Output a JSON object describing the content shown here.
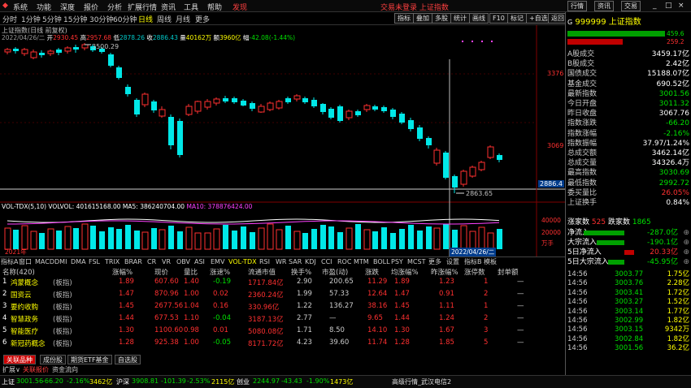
{
  "menu": {
    "items": [
      "系统",
      "功能",
      "深度",
      "报价",
      "分析",
      "扩展行情",
      "资讯",
      "工具",
      "帮助",
      "发现"
    ],
    "center_text": "交易未登录 上证指数",
    "right_buttons": [
      "行情",
      "资讯",
      "交易"
    ],
    "window_controls": [
      "_",
      "□",
      "×"
    ]
  },
  "toolbar": {
    "periods": [
      "分时",
      "1分钟",
      "5分钟",
      "15分钟",
      "30分钟",
      "60分钟",
      "日线",
      "周线",
      "月线",
      "更多"
    ],
    "active_period": "日线",
    "right_buttons": [
      "指标",
      "叠加",
      "多股",
      "统计",
      "画线",
      "F10",
      "标记",
      "+自选",
      "返回"
    ]
  },
  "chart_header": {
    "title": "上证指数(日线 前复权)",
    "date": "2022/04/26/二",
    "open_label": "开",
    "open": "2930.45",
    "high_label": "高",
    "high": "2957.68",
    "low_label": "低",
    "low": "2878.26",
    "close_label": "收",
    "close": "2886.43",
    "vol_label": "量",
    "vol": "40162万",
    "amt_label": "额",
    "amt": "3960亿",
    "chg_label": "幅",
    "chg": "-42.08(-1.44%)"
  },
  "price_axis": [
    "3376",
    "3069",
    "2886.4"
  ],
  "annotations": {
    "high_mark": "3500.29",
    "low_mark": "2863.65"
  },
  "volume_header": {
    "name": "VOL-TDX(5,10)",
    "vol": "VOLVOL: 401615168.00",
    "ma5": "MA5: 386240704.00",
    "ma10": "MA10: 378876424.00"
  },
  "volume_axis": [
    "40000",
    "20000",
    "万手"
  ],
  "chart_date_labels": {
    "left": "2021年",
    "cursor": "2022/04/26/二"
  },
  "indicator_tabs": [
    "指标A",
    "窗口",
    "MACD",
    "DMI",
    "DMA",
    "FSL",
    "TRIX",
    "BRAR",
    "CR",
    "VR",
    "OBV",
    "ASI",
    "EMV",
    "VOL-TDX",
    "RSI",
    "WR",
    "SAR",
    "KDJ",
    "CCI",
    "ROC",
    "MTM",
    "BOLL",
    "PSY",
    "MCST",
    "更多",
    "设置",
    "指标B",
    "模板"
  ],
  "table": {
    "headers": [
      "名称(420)",
      "涨幅%",
      "现价",
      "量比",
      "涨速%",
      "流通市值",
      "换手%",
      "市盈(动)",
      "涨跌",
      "均涨幅%",
      "昨涨幅%",
      "涨停数",
      "封单额"
    ],
    "rows": [
      {
        "idx": "1",
        "name": "鸿蒙概念",
        "tag": "(板指)",
        "chg": "1.89",
        "price": "607.60",
        "vr": "1.40",
        "speed": "-0.19",
        "cap": "1717.84亿",
        "turn": "2.90",
        "pe": "200.65",
        "diff": "11.29",
        "avg": "1.89",
        "prev": "1.23",
        "lim": "1",
        "seal": "—"
      },
      {
        "idx": "2",
        "name": "国资云",
        "tag": "(板指)",
        "chg": "1.47",
        "price": "870.96",
        "vr": "1.00",
        "speed": "0.02",
        "cap": "2360.24亿",
        "turn": "1.99",
        "pe": "57.33",
        "diff": "12.64",
        "avg": "1.47",
        "prev": "0.91",
        "lim": "2",
        "seal": "—"
      },
      {
        "idx": "3",
        "name": "要约收购",
        "tag": "(板指)",
        "chg": "1.45",
        "price": "2677.56",
        "vr": "1.04",
        "speed": "0.16",
        "cap": "330.96亿",
        "turn": "1.22",
        "pe": "136.27",
        "diff": "38.16",
        "avg": "1.45",
        "prev": "1.11",
        "lim": "1",
        "seal": "—"
      },
      {
        "idx": "4",
        "name": "智慧政务",
        "tag": "(板指)",
        "chg": "1.44",
        "price": "677.53",
        "vr": "1.10",
        "speed": "-0.04",
        "cap": "3187.13亿",
        "turn": "2.77",
        "pe": "—",
        "diff": "9.65",
        "avg": "1.44",
        "prev": "1.24",
        "lim": "2",
        "seal": "—"
      },
      {
        "idx": "5",
        "name": "智能医疗",
        "tag": "(板指)",
        "chg": "1.30",
        "price": "1100.60",
        "vr": "0.98",
        "speed": "0.01",
        "cap": "5080.08亿",
        "turn": "1.71",
        "pe": "8.50",
        "diff": "14.10",
        "avg": "1.30",
        "prev": "1.67",
        "lim": "3",
        "seal": "—"
      },
      {
        "idx": "6",
        "name": "新冠药概念",
        "tag": "(板指)",
        "chg": "1.28",
        "price": "925.38",
        "vr": "1.00",
        "speed": "-0.05",
        "cap": "8171.72亿",
        "turn": "4.23",
        "pe": "39.60",
        "diff": "11.74",
        "avg": "1.28",
        "prev": "1.85",
        "lim": "5",
        "seal": "—"
      }
    ]
  },
  "bottom_tabs": [
    "关联品种",
    "成份股",
    "期货ETF基金",
    "自选股"
  ],
  "bottom_sub_tabs": [
    "扩展∨",
    "关联报价",
    "资金流向"
  ],
  "status": {
    "sh_label": "上证",
    "sh_price": "3001.56",
    "sh_chg": "-66.20",
    "sh_pct": "-2.16%",
    "sh_amt": "3462亿",
    "sz_label": "沪深",
    "sz_price": "3908.81",
    "sz_chg": "-101.39",
    "sz_pct": "-2.53%",
    "sz_amt": "2115亿",
    "cy_label": "创业",
    "cy_price": "2244.97",
    "cy_chg": "-43.43",
    "cy_pct": "-1.90%",
    "cy_amt": "1473亿",
    "server": "高级行情_武汉电信2"
  },
  "right_panel": {
    "code": "999999",
    "name": "上证指数",
    "bars": [
      {
        "val": "459.6"
      },
      {
        "val": "259.2"
      }
    ],
    "rows": [
      {
        "label": "A股成交",
        "val": "3459.17亿",
        "color": "white"
      },
      {
        "label": "B股成交",
        "val": "2.42亿",
        "color": "white"
      },
      {
        "label": "国债成交",
        "val": "15188.07亿",
        "color": "white"
      },
      {
        "label": "基金成交",
        "val": "690.52亿",
        "color": "white"
      },
      {
        "label": "最新指数",
        "val": "3001.56",
        "color": "green"
      },
      {
        "label": "今日开盘",
        "val": "3011.32",
        "color": "green"
      },
      {
        "label": "昨日收盘",
        "val": "3067.76",
        "color": "white"
      },
      {
        "label": "指数涨跌",
        "val": "-66.20",
        "color": "green"
      },
      {
        "label": "指数涨幅",
        "val": "-2.16%",
        "color": "green"
      },
      {
        "label": "指数振幅",
        "val": "37.97/1.24%",
        "color": "white"
      },
      {
        "label": "总成交额",
        "val": "3462.14亿",
        "color": "white"
      },
      {
        "label": "总成交量",
        "val": "34326.4万",
        "color": "white"
      },
      {
        "label": "最高指数",
        "val": "3030.69",
        "color": "green"
      },
      {
        "label": "最低指数",
        "val": "2992.72",
        "color": "green"
      },
      {
        "label": "委买量比",
        "val": "26.05%",
        "color": "red"
      },
      {
        "label": "上证换手",
        "val": "0.84%",
        "color": "white"
      }
    ],
    "updown": {
      "up_label": "涨家数",
      "up": "525",
      "down_label": "跌家数",
      "down": "1865"
    },
    "flows": [
      {
        "label": "净流入",
        "val": "-287.0亿",
        "color": "green"
      },
      {
        "label": "大宗流入",
        "val": "-190.1亿",
        "color": "green"
      },
      {
        "label": "5日净流入",
        "val": "20.33亿",
        "color": "red"
      },
      {
        "label": "5日大宗流入",
        "val": "-45.95亿",
        "color": "green"
      }
    ],
    "trades": [
      {
        "t": "14:56",
        "p": "3003.77",
        "v": "1.75亿"
      },
      {
        "t": "14:56",
        "p": "3003.76",
        "v": "2.28亿"
      },
      {
        "t": "14:56",
        "p": "3003.41",
        "v": "1.72亿"
      },
      {
        "t": "14:56",
        "p": "3003.27",
        "v": "1.52亿"
      },
      {
        "t": "14:56",
        "p": "3003.14",
        "v": "1.77亿"
      },
      {
        "t": "14:56",
        "p": "3002.99",
        "v": "1.82亿"
      },
      {
        "t": "14:56",
        "p": "3003.15",
        "v": "9342万"
      },
      {
        "t": "14:56",
        "p": "3002.84",
        "v": "1.82亿"
      },
      {
        "t": "14:56",
        "p": "3001.56",
        "v": "36.2亿"
      }
    ]
  },
  "colors": {
    "up": "#ff3030",
    "down": "#00e0e0",
    "bg": "#000000",
    "accent": "#ffff00"
  }
}
